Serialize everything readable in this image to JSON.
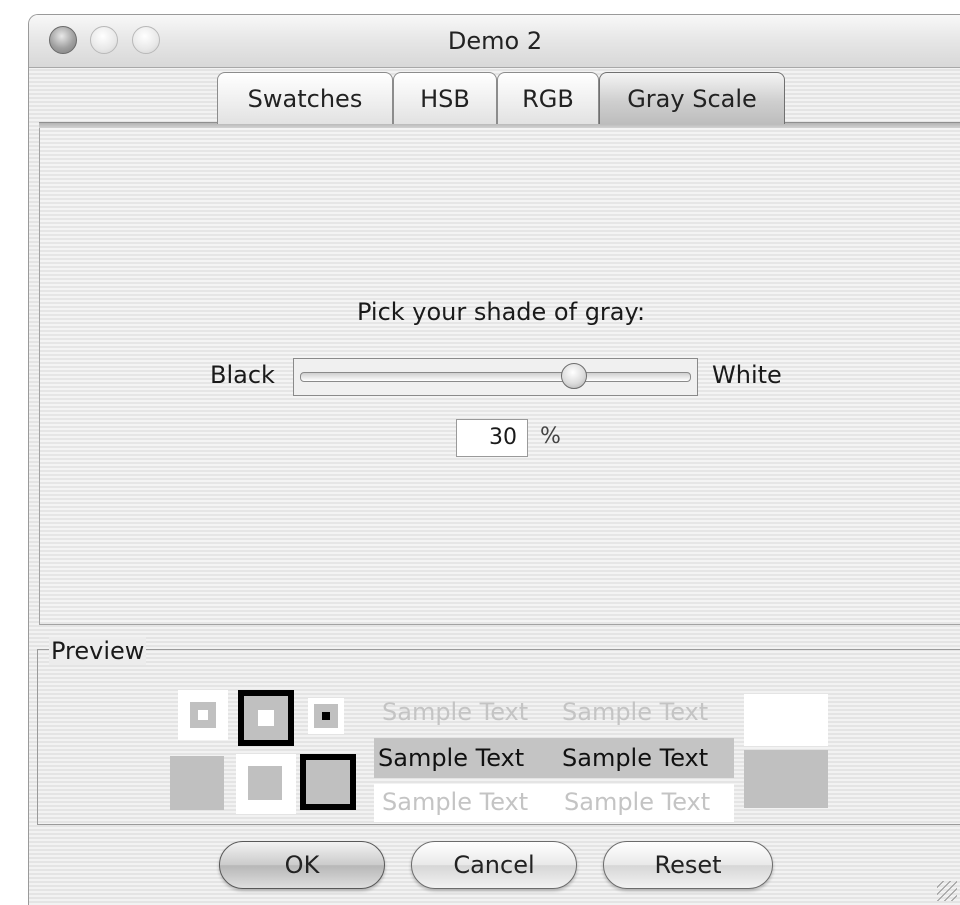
{
  "window": {
    "title": "Demo 2"
  },
  "tabs": [
    {
      "label": "Swatches",
      "selected": false
    },
    {
      "label": "HSB",
      "selected": false
    },
    {
      "label": "RGB",
      "selected": false
    },
    {
      "label": "Gray Scale",
      "selected": true
    }
  ],
  "gray_panel": {
    "prompt": "Pick your shade of gray:",
    "min_label": "Black",
    "max_label": "White",
    "value": "30",
    "unit": "%",
    "slider_fraction": 0.7
  },
  "preview": {
    "title": "Preview",
    "sample_text": "Sample Text",
    "swatch_color": "#c0c0c0"
  },
  "buttons": {
    "ok": "OK",
    "cancel": "Cancel",
    "reset": "Reset"
  },
  "icons": {
    "close": "close-button-icon",
    "minimize": "minimize-button-icon",
    "zoom": "zoom-button-icon",
    "resize": "resize-grip-icon"
  }
}
